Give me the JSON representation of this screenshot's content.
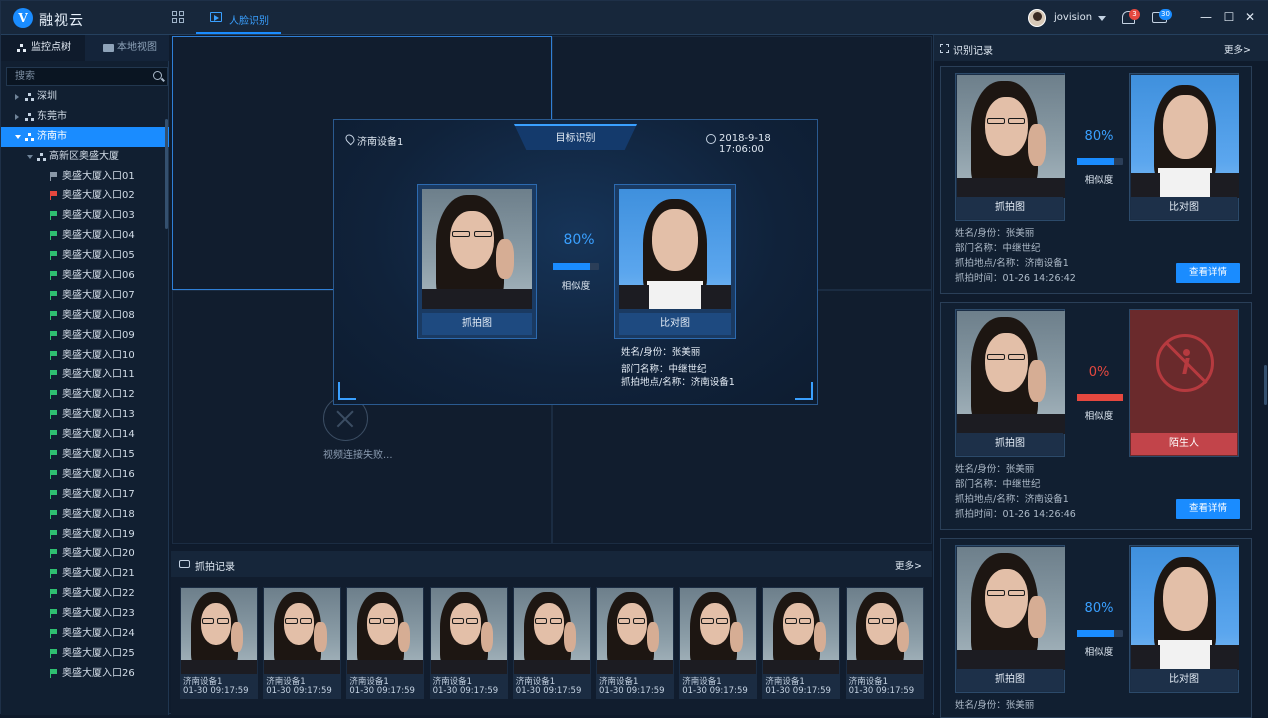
{
  "app": {
    "name": "融视云",
    "logo_letter": "V"
  },
  "topbar": {
    "active_tab": "人脸识别",
    "user": "jovision",
    "notify_count": "3",
    "message_count": "30",
    "minimize": "—",
    "maximize": "☐",
    "close": "✕"
  },
  "left": {
    "tab_tree": "监控点树",
    "tab_local": "本地视图",
    "search_placeholder": "搜索",
    "regions": [
      "深圳",
      "东莞市",
      "济南市"
    ],
    "building": "高新区奥盛大厦",
    "devices": [
      {
        "label": "奥盛大厦入口01",
        "status": "gray"
      },
      {
        "label": "奥盛大厦入口02",
        "status": "red"
      },
      {
        "label": "奥盛大厦入口03",
        "status": "green"
      },
      {
        "label": "奥盛大厦入口04",
        "status": "green"
      },
      {
        "label": "奥盛大厦入口05",
        "status": "green"
      },
      {
        "label": "奥盛大厦入口06",
        "status": "green"
      },
      {
        "label": "奥盛大厦入口07",
        "status": "green"
      },
      {
        "label": "奥盛大厦入口08",
        "status": "green"
      },
      {
        "label": "奥盛大厦入口09",
        "status": "green"
      },
      {
        "label": "奥盛大厦入口10",
        "status": "green"
      },
      {
        "label": "奥盛大厦入口11",
        "status": "green"
      },
      {
        "label": "奥盛大厦入口12",
        "status": "green"
      },
      {
        "label": "奥盛大厦入口13",
        "status": "green"
      },
      {
        "label": "奥盛大厦入口14",
        "status": "green"
      },
      {
        "label": "奥盛大厦入口15",
        "status": "green"
      },
      {
        "label": "奥盛大厦入口16",
        "status": "green"
      },
      {
        "label": "奥盛大厦入口17",
        "status": "green"
      },
      {
        "label": "奥盛大厦入口18",
        "status": "green"
      },
      {
        "label": "奥盛大厦入口19",
        "status": "green"
      },
      {
        "label": "奥盛大厦入口20",
        "status": "green"
      },
      {
        "label": "奥盛大厦入口21",
        "status": "green"
      },
      {
        "label": "奥盛大厦入口22",
        "status": "green"
      },
      {
        "label": "奥盛大厦入口23",
        "status": "green"
      },
      {
        "label": "奥盛大厦入口24",
        "status": "green"
      },
      {
        "label": "奥盛大厦入口25",
        "status": "green"
      },
      {
        "label": "奥盛大厦入口26",
        "status": "green"
      }
    ]
  },
  "video": {
    "fail_text": "视频连接失败..."
  },
  "popup": {
    "title": "目标识别",
    "location": "济南设备1",
    "time": "2018-9-18  17:06:00",
    "similarity": "80%",
    "similarity_value": 0.8,
    "similarity_label": "相似度",
    "capture_label": "抓拍图",
    "compare_label": "比对图",
    "name_line": "姓名/身份：张美丽",
    "dept_line": "部门名称：中继世纪",
    "place_line": "抓拍地点/名称：济南设备1"
  },
  "capture_record": {
    "title": "抓拍记录",
    "more": "更多>",
    "items": [
      {
        "device": "济南设备1",
        "time": "01-30 09:17:59"
      },
      {
        "device": "济南设备1",
        "time": "01-30 09:17:59"
      },
      {
        "device": "济南设备1",
        "time": "01-30 09:17:59"
      },
      {
        "device": "济南设备1",
        "time": "01-30 09:17:59"
      },
      {
        "device": "济南设备1",
        "time": "01-30 09:17:59"
      },
      {
        "device": "济南设备1",
        "time": "01-30 09:17:59"
      },
      {
        "device": "济南设备1",
        "time": "01-30 09:17:59"
      },
      {
        "device": "济南设备1",
        "time": "01-30 09:17:59"
      },
      {
        "device": "济南设备1",
        "time": "01-30 09:17:59"
      }
    ]
  },
  "recognition": {
    "title": "识别记录",
    "more": "更多>",
    "records": [
      {
        "similarity": "80%",
        "similarity_value": 0.8,
        "similarity_label": "相似度",
        "capture_label": "抓拍图",
        "compare_label": "比对图",
        "stranger": false,
        "name": "姓名/身份：张美丽",
        "dept": "部门名称：中继世纪",
        "place": "抓拍地点/名称：济南设备1",
        "time": "抓拍时间：01-26   14:26:42",
        "detail_btn": "查看详情"
      },
      {
        "similarity": "0%",
        "similarity_value": 0.0,
        "similarity_label": "相似度",
        "capture_label": "抓拍图",
        "compare_label": "陌生人",
        "stranger": true,
        "name": "姓名/身份：张美丽",
        "dept": "部门名称：中继世纪",
        "place": "抓拍地点/名称：济南设备1",
        "time": "抓拍时间：01-26   14:26:46",
        "detail_btn": "查看详情"
      },
      {
        "similarity": "80%",
        "similarity_value": 0.8,
        "similarity_label": "相似度",
        "capture_label": "抓拍图",
        "compare_label": "比对图",
        "stranger": false,
        "name": "姓名/身份：张美丽"
      }
    ]
  },
  "colors": {
    "accent": "#1a8cff",
    "danger": "#e5483f",
    "online": "#2fbf71"
  }
}
